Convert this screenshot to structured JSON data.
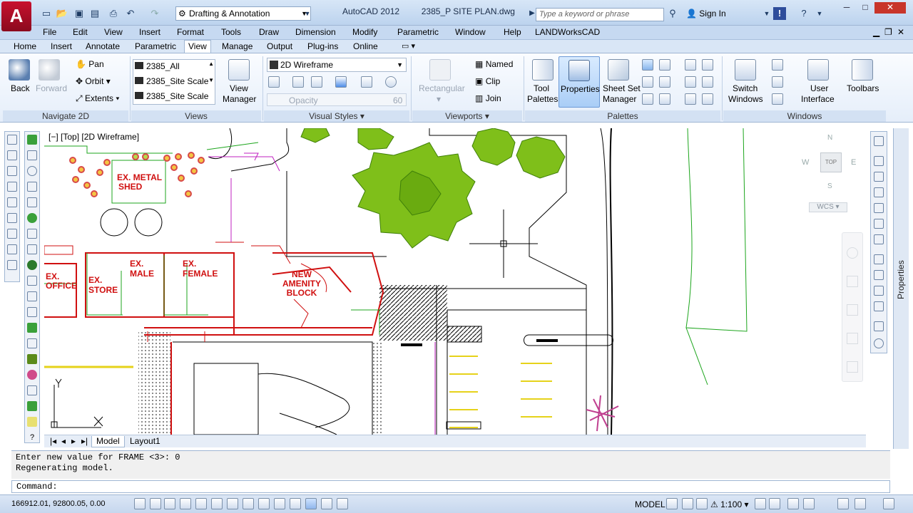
{
  "app": {
    "logo": "A",
    "title": "AutoCAD 2012",
    "file": "2385_P SITE PLAN.dwg",
    "workspace": "Drafting & Annotation",
    "search_placeholder": "Type a keyword or phrase",
    "signin": "Sign In"
  },
  "menu": [
    "File",
    "Edit",
    "View",
    "Insert",
    "Format",
    "Tools",
    "Draw",
    "Dimension",
    "Modify",
    "Parametric",
    "Window",
    "Help",
    "LANDWorksCAD"
  ],
  "ribbon_tabs": [
    "Home",
    "Insert",
    "Annotate",
    "Parametric",
    "View",
    "Manage",
    "Output",
    "Plug-ins",
    "Online"
  ],
  "active_tab": "View",
  "ribbon": {
    "navigate": {
      "title": "Navigate 2D",
      "back": "Back",
      "forward": "Forward",
      "pan": "Pan",
      "orbit": "Orbit",
      "extents": "Extents"
    },
    "views": {
      "title": "Views",
      "items": [
        "2385_All",
        "2385_Site Scale",
        "2385_Site Scale"
      ],
      "view_manager_line1": "View",
      "view_manager_line2": "Manager"
    },
    "visual_styles": {
      "title": "Visual Styles",
      "current": "2D Wireframe",
      "opacity_label": "Opacity",
      "opacity_value": "60"
    },
    "viewports": {
      "title": "Viewports",
      "rectangular": "Rectangular",
      "named": "Named",
      "clip": "Clip",
      "join": "Join"
    },
    "palettes": {
      "title": "Palettes",
      "tool_palettes_line1": "Tool",
      "tool_palettes_line2": "Palettes",
      "properties": "Properties",
      "sheet_set_line1": "Sheet Set",
      "sheet_set_line2": "Manager"
    },
    "windows": {
      "title": "Windows",
      "switch_line1": "Switch",
      "switch_line2": "Windows",
      "ui_line1": "User",
      "ui_line2": "Interface",
      "toolbars": "Toolbars"
    }
  },
  "viewport": {
    "label": "[−] [Top] [2D Wireframe]",
    "shed_line1": "EX. METAL",
    "shed_line2": "SHED",
    "office_line1": "EX.",
    "office_line2": "OFFICE",
    "store_line1": "EX.",
    "store_line2": "STORE",
    "male_line1": "EX.",
    "male_line2": "MALE",
    "female_line1": "EX.",
    "female_line2": "FEMALE",
    "amenity_line1": "NEW",
    "amenity_line2": "AMENITY",
    "amenity_line3": "BLOCK",
    "viewcube": {
      "n": "N",
      "s": "S",
      "e": "E",
      "w": "W",
      "face": "TOP",
      "wcs": "WCS"
    },
    "ucs_y": "Y",
    "ucs_x": "X"
  },
  "layout_tabs": [
    "Model",
    "Layout1"
  ],
  "active_layout": "Model",
  "command": {
    "history": [
      "Enter new value for FRAME <3>: 0",
      "Regenerating model."
    ],
    "prompt": "Command:"
  },
  "status": {
    "coords": "166912.01, 92800.05, 0.00",
    "space": "MODEL",
    "scale": "1:100"
  },
  "side_palette": "Properties",
  "colors": {
    "ribbon_bg": "#e5eefa",
    "accent": "#c8102e",
    "tree_green": "#7fbf1a",
    "wall_red": "#d01010"
  }
}
